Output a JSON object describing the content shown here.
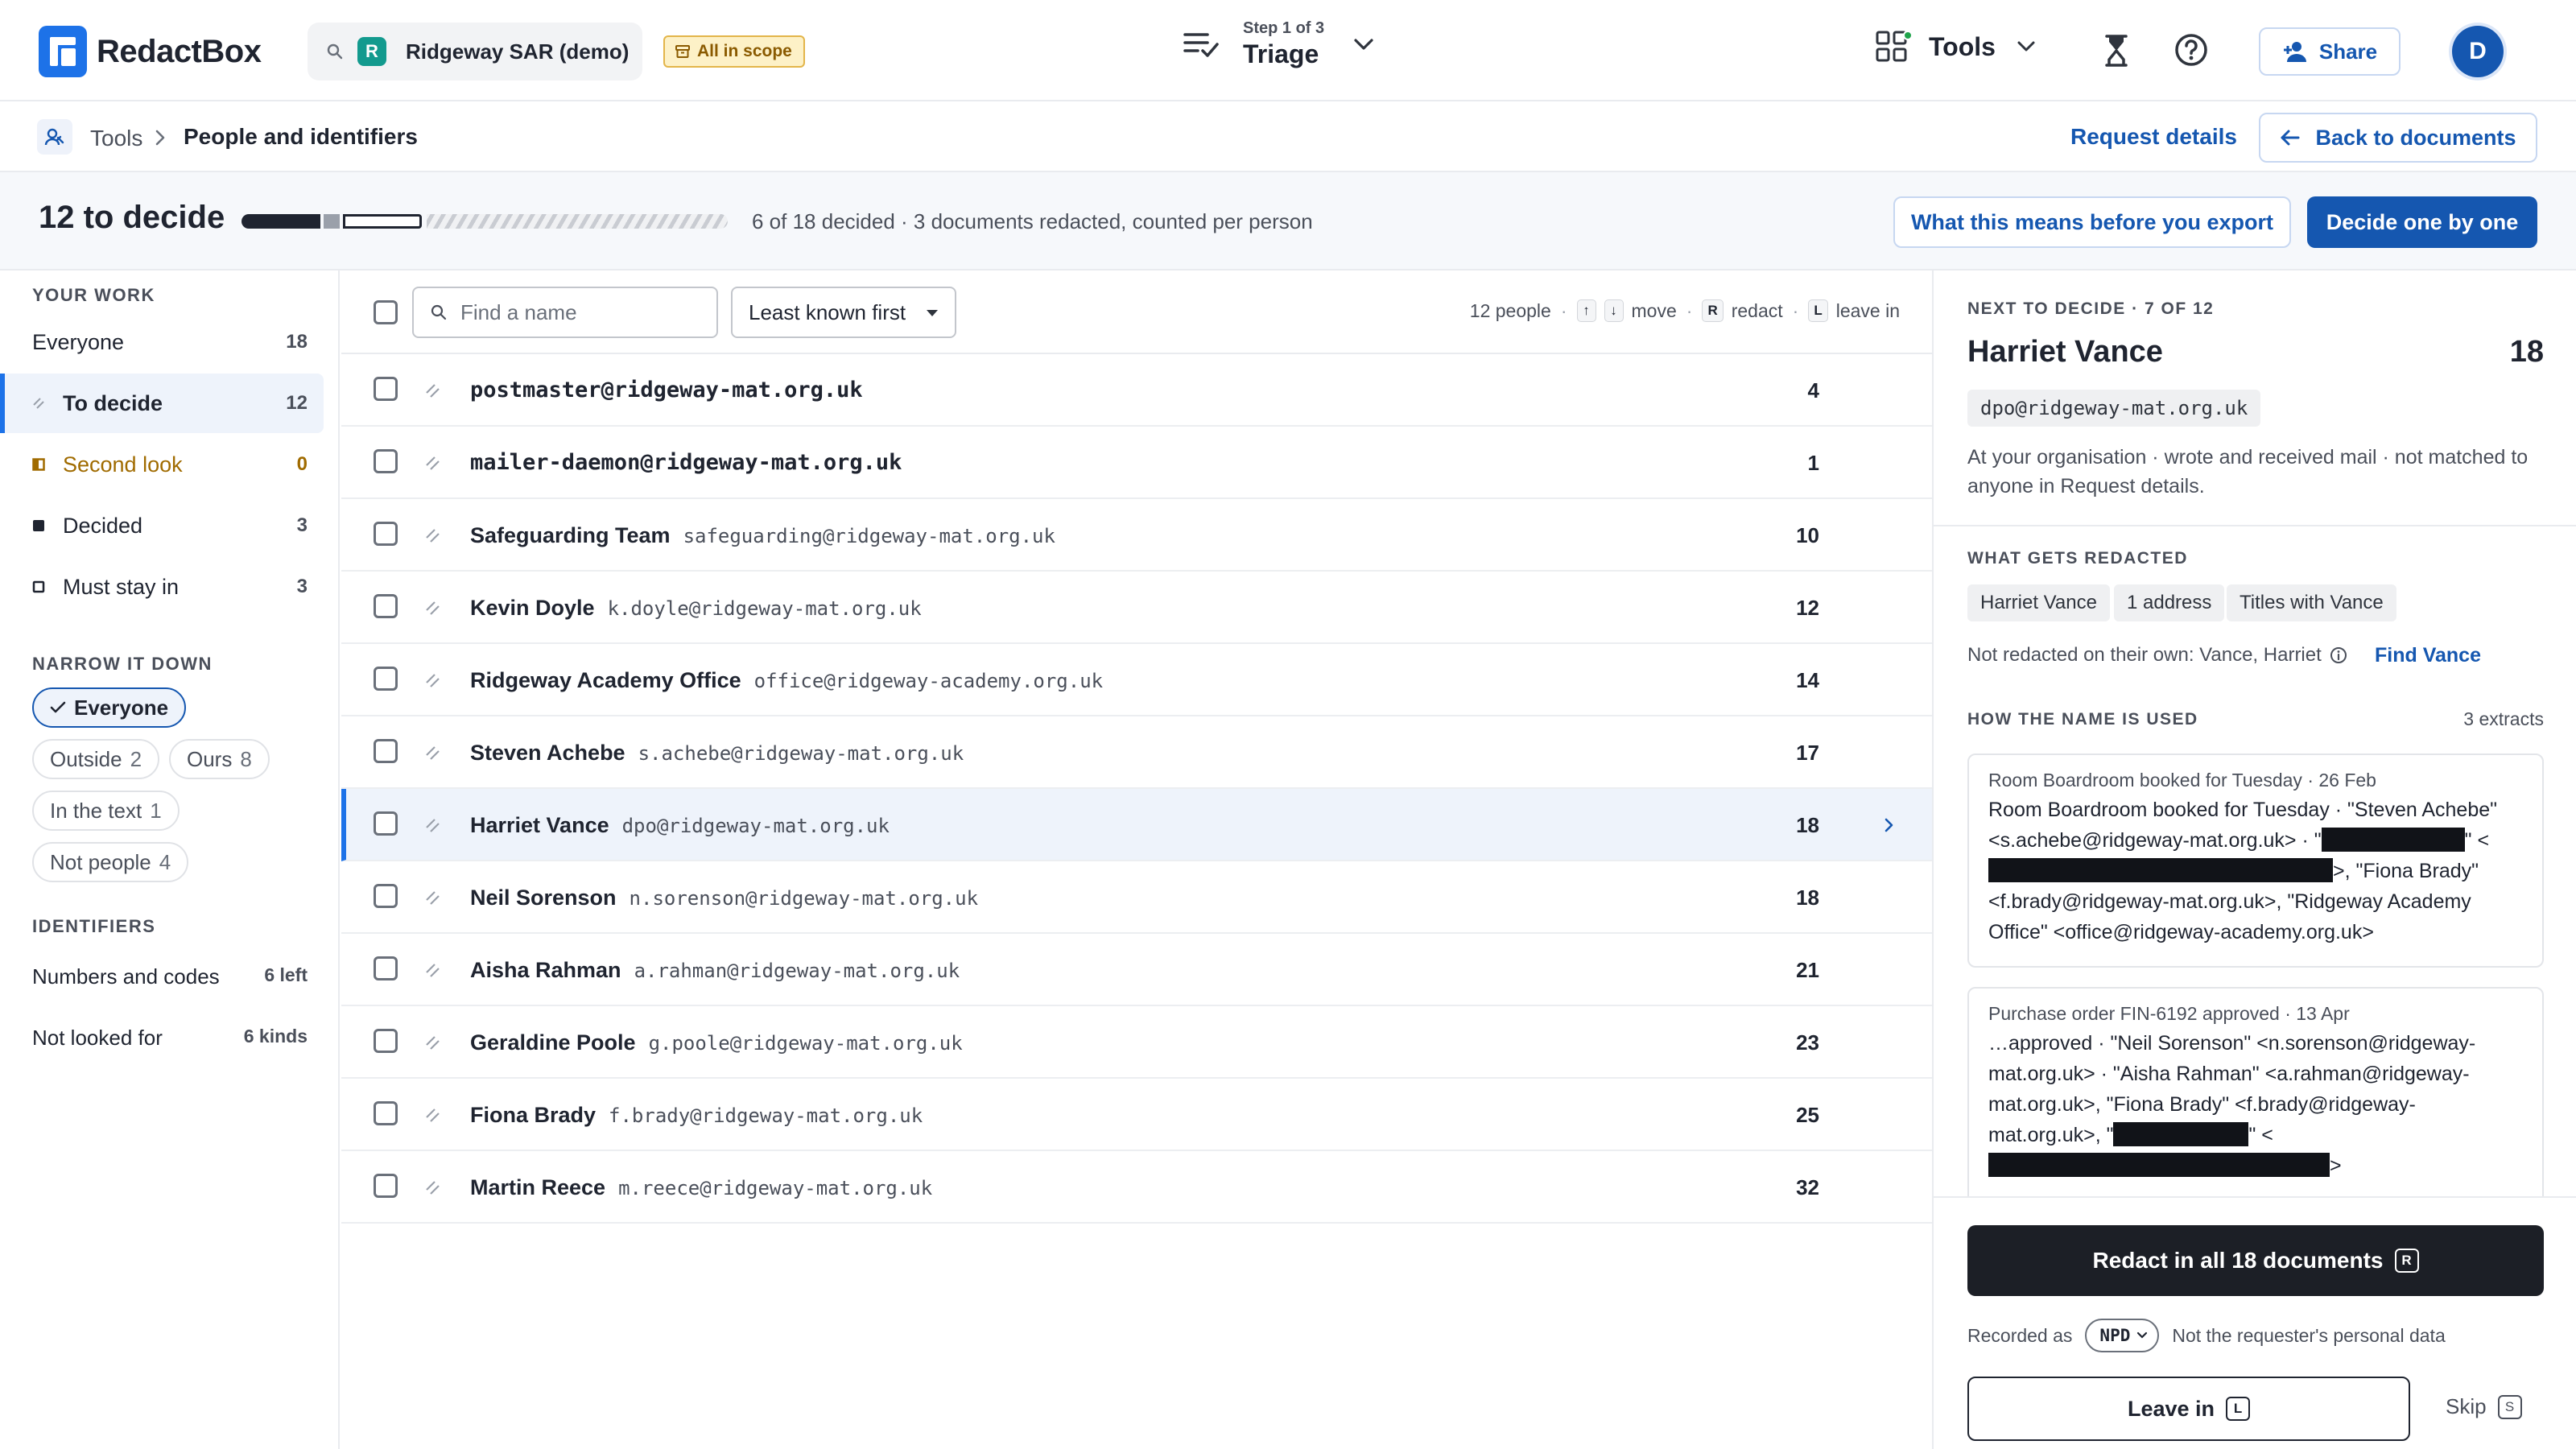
{
  "app": {
    "name": "RedactBox"
  },
  "project": {
    "avatar_letter": "R",
    "name": "Ridgeway SAR (demo)",
    "scope_badge": "All in scope"
  },
  "step": {
    "counter": "Step 1 of 3",
    "name": "Triage"
  },
  "header": {
    "tools_label": "Tools",
    "share_label": "Share",
    "user_initial": "D"
  },
  "breadcrumb": {
    "root": "Tools",
    "current": "People and identifiers",
    "request_link": "Request details",
    "back_label": "Back to documents"
  },
  "summary": {
    "heading": "12 to decide",
    "description": "6 of 18 decided · 3 documents redacted, counted per person",
    "explain_button": "What this means before you export",
    "decide_button": "Decide one by one",
    "progress": {
      "decided": 3,
      "second_look": 0,
      "must_stay_in": 3,
      "to_decide": 12,
      "total": 18
    }
  },
  "sidebar": {
    "your_work_heading": "YOUR WORK",
    "items": [
      {
        "label": "Everyone",
        "count": "18"
      },
      {
        "label": "To decide",
        "count": "12"
      },
      {
        "label": "Second look",
        "count": "0"
      },
      {
        "label": "Decided",
        "count": "3"
      },
      {
        "label": "Must stay in",
        "count": "3"
      }
    ],
    "narrow_heading": "NARROW IT DOWN",
    "chips": [
      {
        "label": "Everyone",
        "count": ""
      },
      {
        "label": "Outside",
        "count": "2"
      },
      {
        "label": "Ours",
        "count": "8"
      },
      {
        "label": "In the text",
        "count": "1"
      },
      {
        "label": "Not people",
        "count": "4"
      }
    ],
    "identifiers_heading": "IDENTIFIERS",
    "identifiers": [
      {
        "label": "Numbers and codes",
        "value": "6 left"
      },
      {
        "label": "Not looked for",
        "value": "6 kinds"
      }
    ]
  },
  "list": {
    "search_placeholder": "Find a name",
    "sort_value": "Least known first",
    "people_count": "12 people",
    "hints": {
      "move_keys": [
        "↑",
        "↓"
      ],
      "move": "move",
      "redact_key": "R",
      "redact": "redact",
      "leave_key": "L",
      "leave": "leave in"
    },
    "rows": [
      {
        "name": "postmaster@ridgeway-mat.org.uk",
        "email": "",
        "count": "4"
      },
      {
        "name": "mailer-daemon@ridgeway-mat.org.uk",
        "email": "",
        "count": "1"
      },
      {
        "name": "Safeguarding Team",
        "email": "safeguarding@ridgeway-mat.org.uk",
        "count": "10"
      },
      {
        "name": "Kevin Doyle",
        "email": "k.doyle@ridgeway-mat.org.uk",
        "count": "12"
      },
      {
        "name": "Ridgeway Academy Office",
        "email": "office@ridgeway-academy.org.uk",
        "count": "14"
      },
      {
        "name": "Steven Achebe",
        "email": "s.achebe@ridgeway-mat.org.uk",
        "count": "17"
      },
      {
        "name": "Harriet Vance",
        "email": "dpo@ridgeway-mat.org.uk",
        "count": "18"
      },
      {
        "name": "Neil Sorenson",
        "email": "n.sorenson@ridgeway-mat.org.uk",
        "count": "18"
      },
      {
        "name": "Aisha Rahman",
        "email": "a.rahman@ridgeway-mat.org.uk",
        "count": "21"
      },
      {
        "name": "Geraldine Poole",
        "email": "g.poole@ridgeway-mat.org.uk",
        "count": "23"
      },
      {
        "name": "Fiona Brady",
        "email": "f.brady@ridgeway-mat.org.uk",
        "count": "25"
      },
      {
        "name": "Martin Reece",
        "email": "m.reece@ridgeway-mat.org.uk",
        "count": "32"
      }
    ]
  },
  "panel": {
    "kicker": "NEXT TO DECIDE · 7 OF 12",
    "name": "Harriet Vance",
    "count": "18",
    "email": "dpo@ridgeway-mat.org.uk",
    "description": "At your organisation · wrote and received mail · not matched to anyone in Request details.",
    "redacted_heading": "WHAT GETS REDACTED",
    "tags": [
      "Harriet Vance",
      "1 address",
      "Titles with Vance"
    ],
    "not_redacted": "Not redacted on their own: Vance, Harriet",
    "find_link": "Find Vance",
    "usage_heading": "HOW THE NAME IS USED",
    "extracts_count": "3 extracts",
    "extracts": [
      {
        "meta": "Room Boardroom booked for Tuesday · 26 Feb",
        "t1": "Room Boardroom booked for Tuesday · \"Steven Achebe\" <s.achebe@ridgeway-mat.org.uk> · \"",
        "t2": "\" <",
        "t3": ">, \"Fiona Brady\" <f.brady@ridgeway-mat.org.uk>, \"Ridgeway Academy Office\" <office@ridgeway-academy.org.uk>"
      },
      {
        "meta": "Purchase order FIN-6192 approved · 13 Apr",
        "t1": "…approved · \"Neil Sorenson\" <n.sorenson@ridgeway-mat.org.uk> · \"Aisha Rahman\" <a.rahman@ridgeway-mat.org.uk>, \"Fiona Brady\" <f.brady@ridgeway-mat.org.uk>, \"",
        "t2": "\" <",
        "t3": ">"
      }
    ],
    "redact_button": "Redact in all 18 documents",
    "redact_key": "R",
    "recorded_as_label": "Recorded as",
    "recorded_value": "NPD",
    "recorded_note": "Not the requester's personal data",
    "leave_button": "Leave in",
    "leave_key": "L",
    "skip_label": "Skip",
    "skip_key": "S"
  },
  "colors": {
    "accent": "#1557b0",
    "brand": "#1d72e8",
    "amber": "#a06b00",
    "dark": "#1c1f26"
  }
}
